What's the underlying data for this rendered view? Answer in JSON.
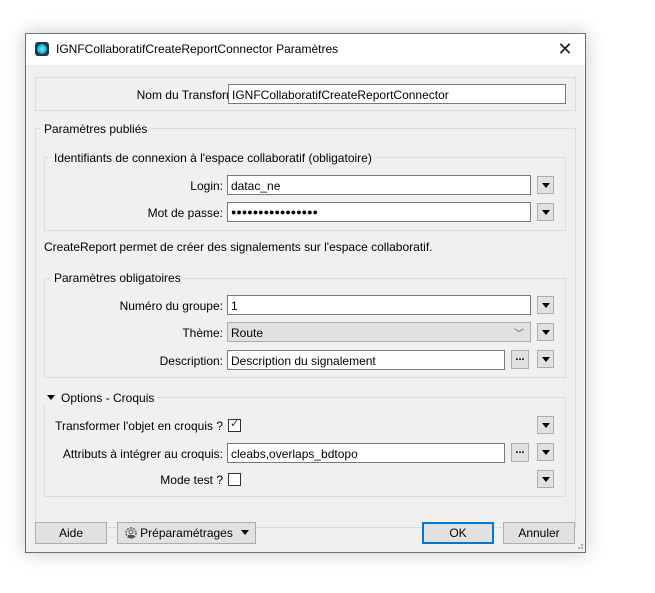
{
  "window": {
    "title": "IGNFCollaboratifCreateReportConnector Paramètres",
    "close_icon": "close-icon",
    "app_icon": "fme-transformer-icon"
  },
  "transformer_name": {
    "label": "Nom du Transformer:",
    "value": "IGNFCollaboratifCreateReportConnector"
  },
  "published": {
    "title": "Paramètres publiés",
    "credentials": {
      "title": "Identifiants de connexion à l'espace collaboratif (obligatoire)",
      "login_label": "Login:",
      "login_value": "datac_ne",
      "password_label": "Mot de passe:",
      "password_value": "●●●●●●●●●●●●●●●●"
    },
    "description_text": "CreateReport permet de créer des signalements sur l'espace collaboratif.",
    "mandatory": {
      "title": "Paramètres obligatoires",
      "group_label": "Numéro du groupe:",
      "group_value": "1",
      "theme_label": "Thème:",
      "theme_value": "Route",
      "description_label": "Description:",
      "description_value": "Description du signalement",
      "ellipsis": "..."
    },
    "options": {
      "title": "Options - Croquis",
      "expanded": true,
      "sketch_label": "Transformer l'objet en croquis ?",
      "sketch_checked": true,
      "attributes_label": "Attributs à intégrer au croquis:",
      "attributes_value": "cleabs,overlaps_bdtopo",
      "ellipsis": "...",
      "test_label": "Mode test ?",
      "test_checked": false
    }
  },
  "footer": {
    "help_label": "Aide",
    "presets_label": "Préparamétrages",
    "ok_label": "OK",
    "cancel_label": "Annuler"
  },
  "colors": {
    "accent": "#0078d7",
    "window_bg": "#f0f0f0",
    "button_bg": "#e1e1e1"
  }
}
